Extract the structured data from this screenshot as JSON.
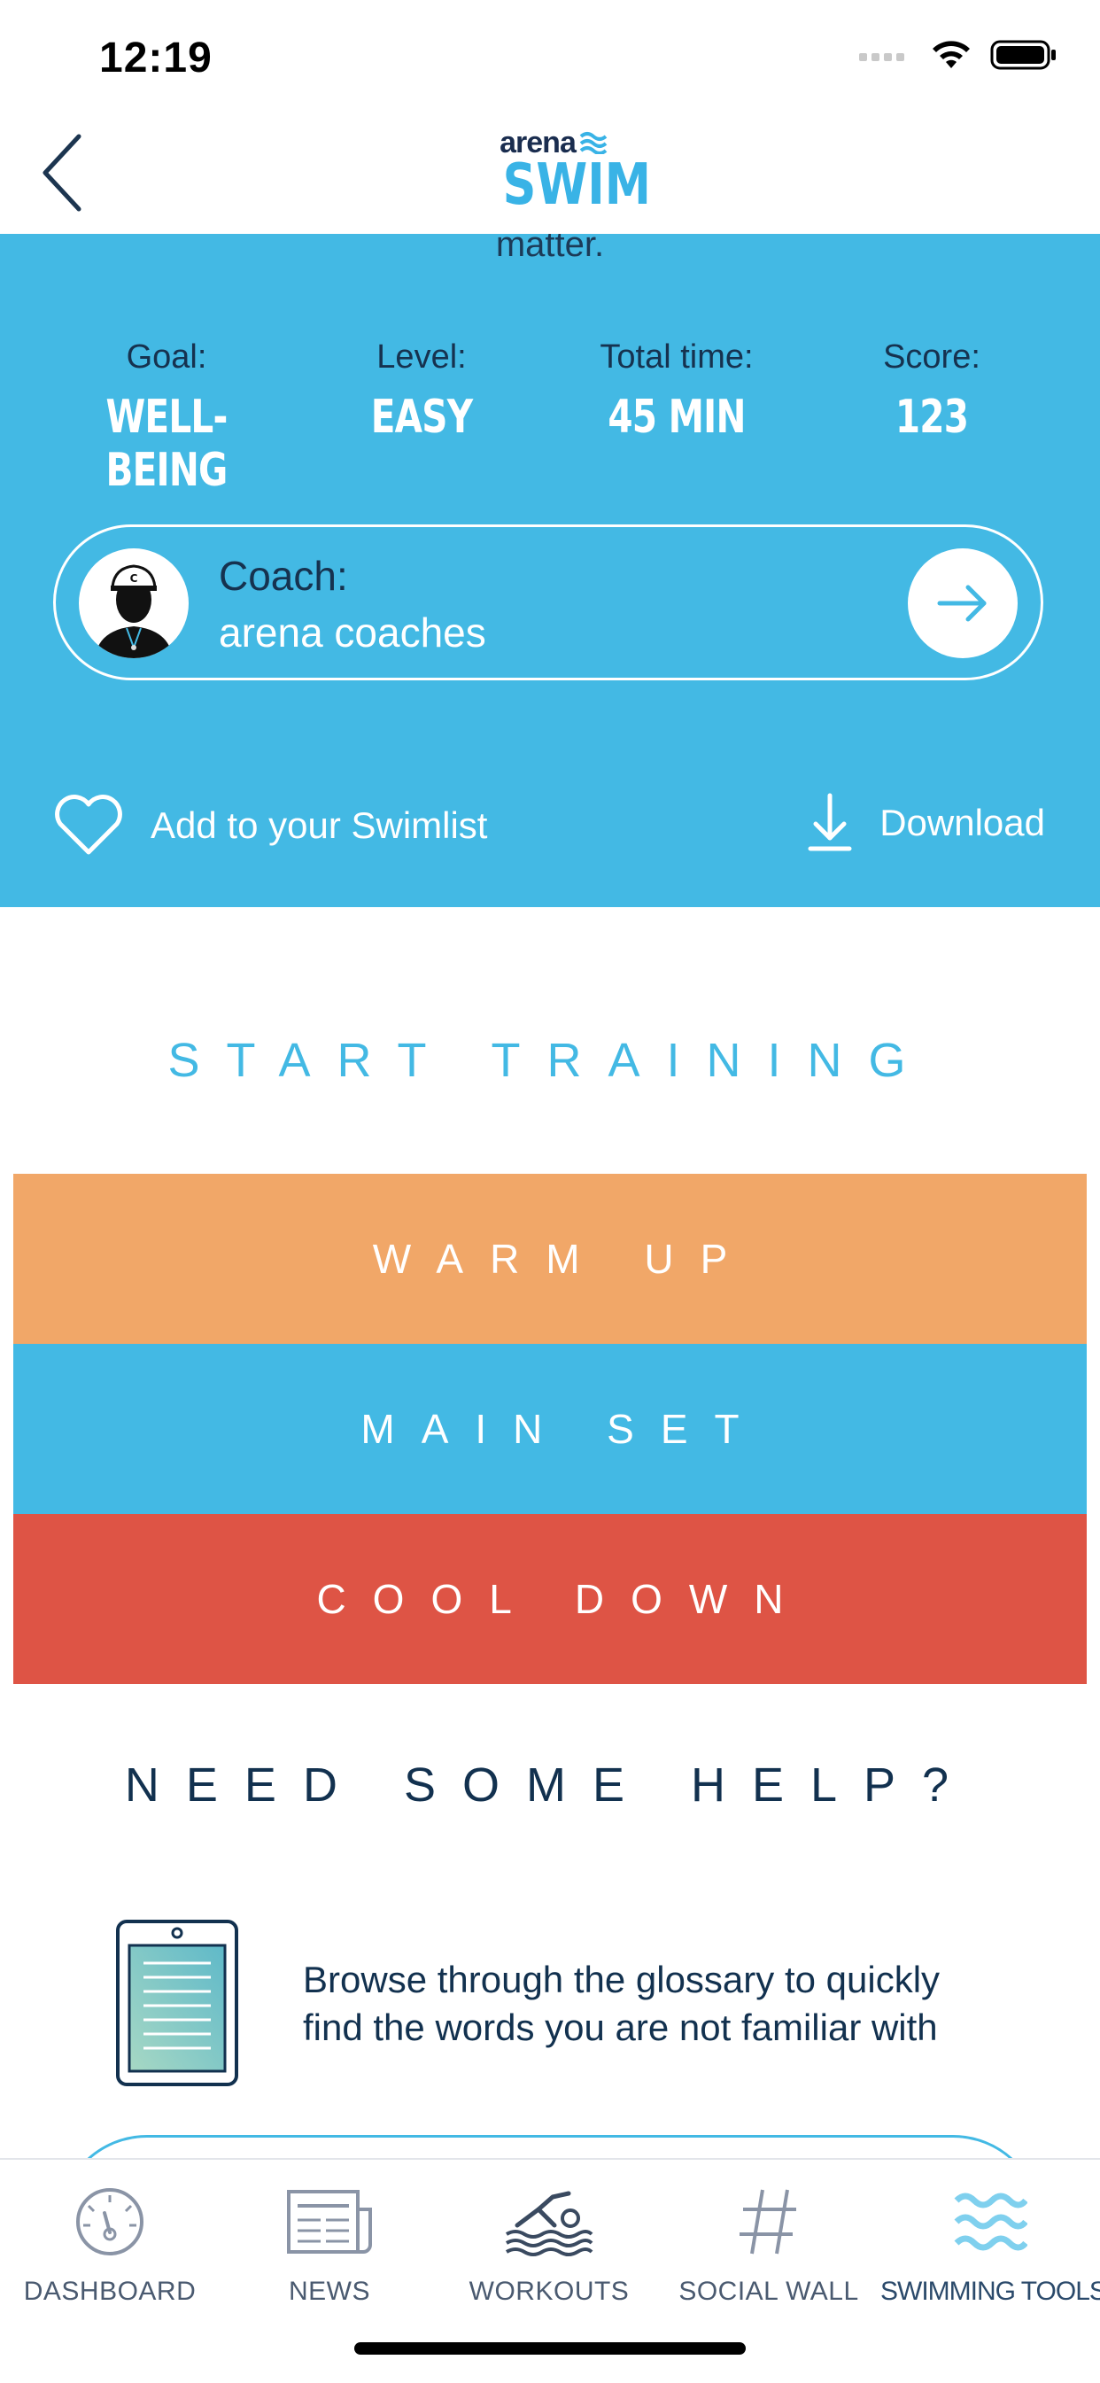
{
  "status_bar": {
    "time": "12:19"
  },
  "header": {
    "logo_top": "arena",
    "logo_bottom": "SWIM"
  },
  "hero": {
    "partial_text": "matter.",
    "stats": [
      {
        "label": "Goal:",
        "value": "WELL-BEING"
      },
      {
        "label": "Level:",
        "value": "EASY"
      },
      {
        "label": "Total time:",
        "value": "45 MIN"
      },
      {
        "label": "Score:",
        "value": "123"
      }
    ],
    "coach": {
      "title": "Coach:",
      "name": "arena coaches"
    },
    "swimlist_label": "Add to your Swimlist",
    "download_label": "Download"
  },
  "training": {
    "title": "START TRAINING",
    "sections": [
      "WARM UP",
      "MAIN SET",
      "COOL DOWN"
    ]
  },
  "help": {
    "title": "NEED SOME HELP?",
    "glossary_line1": "Browse through the glossary to quickly",
    "glossary_line2": "find the words you are not familiar with"
  },
  "tabs": [
    {
      "label": "DASHBOARD",
      "icon": "gauge-icon"
    },
    {
      "label": "NEWS",
      "icon": "newspaper-icon"
    },
    {
      "label": "WORKOUTS",
      "icon": "swimmer-icon"
    },
    {
      "label": "SOCIAL WALL",
      "icon": "hashtag-icon"
    },
    {
      "label": "SWIMMING TOOLS",
      "icon": "waves-icon",
      "active": true
    }
  ],
  "colors": {
    "accent_blue": "#43b9e4",
    "navy": "#12314f",
    "warm_up": "#f1a768",
    "cool_down": "#de5445"
  }
}
